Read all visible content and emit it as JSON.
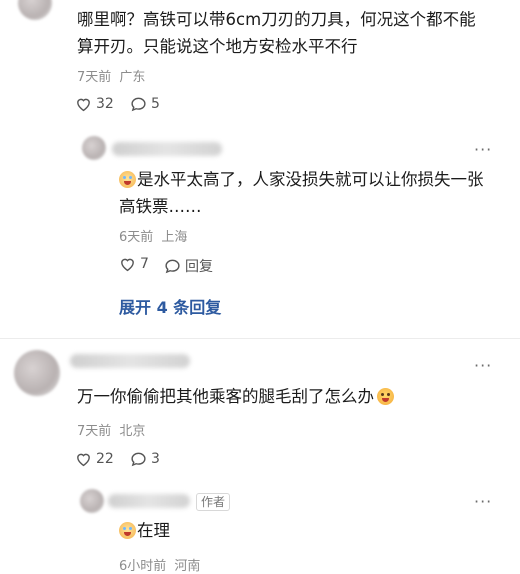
{
  "comments": [
    {
      "text": "哪里啊？高铁可以带6cm刀刃的刀具，何况这个都不能算开刃。只能说这个地方安检水平不行",
      "time": "7天前",
      "location": "广东",
      "likes": "32",
      "replies": "5",
      "icons": {
        "like": "heart-icon",
        "reply": "comment-bubble-icon"
      }
    },
    {
      "text": "是水平太高了，人家没损失就可以让你损失一张高铁票……",
      "time": "6天前",
      "location": "上海",
      "likes": "7",
      "reply_label": "回复",
      "icons": {
        "emoji": "laughing-crying-face-icon"
      }
    },
    {
      "text": "万一你偷偷把其他乘客的腿毛刮了怎么办",
      "time": "7天前",
      "location": "北京",
      "likes": "22",
      "replies": "3",
      "icons": {
        "emoji": "screaming-face-icon"
      }
    },
    {
      "text": "在理",
      "author_tag": "作者",
      "time": "6小时前",
      "location": "河南",
      "icons": {
        "emoji": "laughing-crying-face-icon"
      }
    }
  ],
  "expand_replies": "展开 4 条回复",
  "more_label": "···",
  "colors": {
    "link": "#2d5aa0",
    "meta": "#8c8c8c"
  }
}
